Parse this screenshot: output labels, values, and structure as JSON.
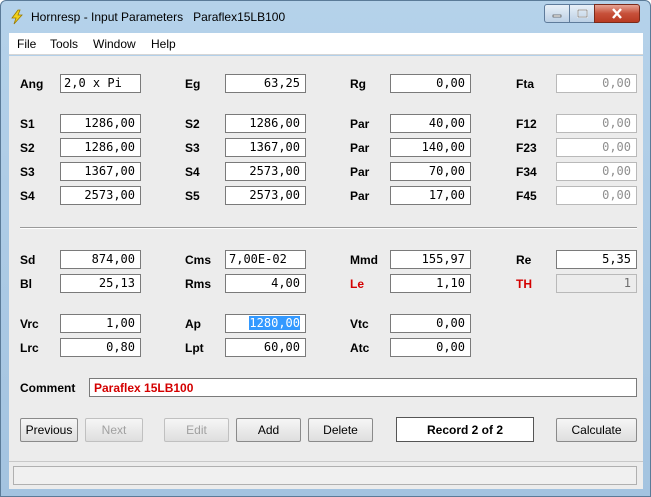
{
  "window": {
    "title": "Hornresp - Input Parameters   Paraflex15LB100",
    "accent_color": "#a3c3e0",
    "close_color": "#c7503a"
  },
  "menu": {
    "items": [
      "File",
      "Tools",
      "Window",
      "Help"
    ]
  },
  "params_top": {
    "ang": {
      "label": "Ang",
      "value": "2,0 x Pi"
    },
    "eg": {
      "label": "Eg",
      "value": "63,25"
    },
    "rg": {
      "label": "Rg",
      "value": "0,00"
    },
    "fta": {
      "label": "Fta",
      "value": "0,00"
    }
  },
  "sections": [
    {
      "s_label": "S1",
      "s_value": "1286,00",
      "n_label": "S2",
      "n_value": "1286,00",
      "p_label": "Par",
      "p_value": "40,00",
      "f_label": "F12",
      "f_value": "0,00"
    },
    {
      "s_label": "S2",
      "s_value": "1286,00",
      "n_label": "S3",
      "n_value": "1367,00",
      "p_label": "Par",
      "p_value": "140,00",
      "f_label": "F23",
      "f_value": "0,00"
    },
    {
      "s_label": "S3",
      "s_value": "1367,00",
      "n_label": "S4",
      "n_value": "2573,00",
      "p_label": "Par",
      "p_value": "70,00",
      "f_label": "F34",
      "f_value": "0,00"
    },
    {
      "s_label": "S4",
      "s_value": "2573,00",
      "n_label": "S5",
      "n_value": "2573,00",
      "p_label": "Par",
      "p_value": "17,00",
      "f_label": "F45",
      "f_value": "0,00"
    }
  ],
  "driver": {
    "sd": {
      "label": "Sd",
      "value": "874,00"
    },
    "cms": {
      "label": "Cms",
      "value": "7,00E-02"
    },
    "mmd": {
      "label": "Mmd",
      "value": "155,97"
    },
    "re": {
      "label": "Re",
      "value": "5,35"
    },
    "bl": {
      "label": "Bl",
      "value": "25,13"
    },
    "rms": {
      "label": "Rms",
      "value": "4,00"
    },
    "le": {
      "label": "Le",
      "value": "1,10"
    },
    "th": {
      "label": "TH",
      "value": "1"
    }
  },
  "chamber": {
    "vrc": {
      "label": "Vrc",
      "value": "1,00"
    },
    "ap": {
      "label": "Ap",
      "value": "1280,00"
    },
    "vtc": {
      "label": "Vtc",
      "value": "0,00"
    },
    "lrc": {
      "label": "Lrc",
      "value": "0,80"
    },
    "lpt": {
      "label": "Lpt",
      "value": "60,00"
    },
    "atc": {
      "label": "Atc",
      "value": "0,00"
    }
  },
  "comment": {
    "label": "Comment",
    "value": "Paraflex 15LB100"
  },
  "buttons": {
    "previous": "Previous",
    "next": "Next",
    "edit": "Edit",
    "add": "Add",
    "delete": "Delete",
    "record": "Record 2 of 2",
    "calculate": "Calculate"
  }
}
